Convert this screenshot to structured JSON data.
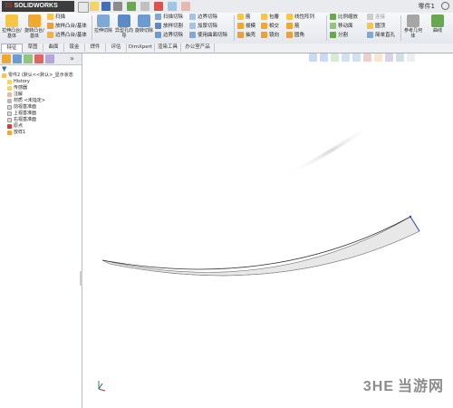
{
  "app": {
    "brand": "SOLIDWORKS",
    "brand_ds": "3S",
    "doc_title": "零件1"
  },
  "ribbon": {
    "big_buttons": [
      {
        "label": "拉伸凸台/基体"
      },
      {
        "label": "旋转凸台/基体"
      },
      {
        "label": "拉伸切除"
      },
      {
        "label": "异型孔向导"
      },
      {
        "label": "旋转切除"
      },
      {
        "label": "参考几何体"
      },
      {
        "label": "曲线"
      }
    ],
    "small_group1": [
      "扫描",
      "放样凸台/基体",
      "边界凸台/基体"
    ],
    "small_group2": [
      "扫描切除",
      "放样切割",
      "边界切除"
    ],
    "small_group3": [
      "边界切除",
      "加厚切除",
      "使用曲面切除"
    ],
    "small_group4": [
      "筋",
      "拔模",
      "抽壳"
    ],
    "small_group5": [
      "包覆",
      "相交",
      "镜向"
    ],
    "small_group6": [
      "线性阵列",
      "筋",
      "圆角"
    ],
    "small_group7": [
      "比例缩放",
      "移动面",
      "分割"
    ],
    "small_group8": [
      "连接",
      "圆顶",
      "简单直孔"
    ]
  },
  "tabs": [
    "特征",
    "草图",
    "曲面",
    "钣金",
    "焊件",
    "评估",
    "DimXpert",
    "渲染工具",
    "办公室产品"
  ],
  "feature_tree": {
    "items": [
      {
        "label": "零件2  (默认<<默认>_显示状态",
        "level": 0
      },
      {
        "label": "History",
        "level": 1
      },
      {
        "label": "传感器",
        "level": 1
      },
      {
        "label": "注解",
        "level": 1
      },
      {
        "label": "材质 <未指定>",
        "level": 1
      },
      {
        "label": "前视基准面",
        "level": 1
      },
      {
        "label": "上视基准面",
        "level": 1
      },
      {
        "label": "右视基准面",
        "level": 1
      },
      {
        "label": "原点",
        "level": 1
      },
      {
        "label": "放样1",
        "level": 1
      }
    ]
  },
  "watermark": {
    "logo": "3HE",
    "text": "当游网"
  }
}
